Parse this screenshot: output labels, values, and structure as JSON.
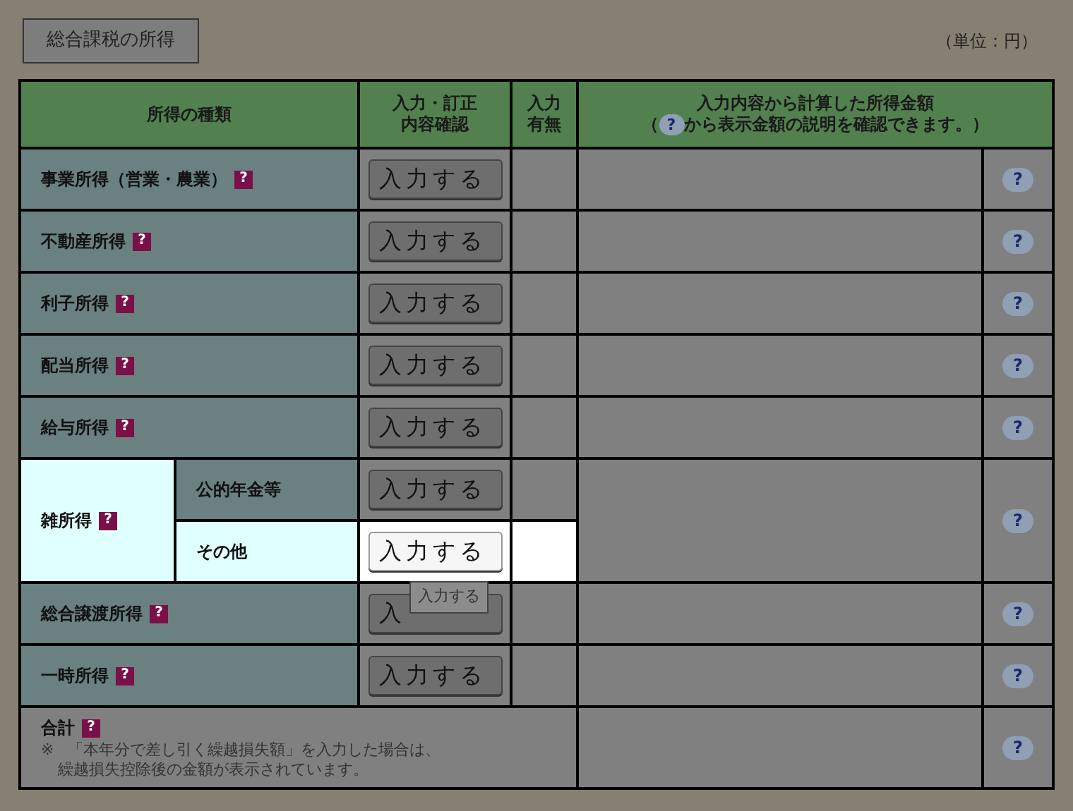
{
  "section_button": "総合課税の所得",
  "unit": "（単位：円）",
  "header": {
    "type": "所得の種類",
    "input": [
      "入力・訂正",
      "内容確認"
    ],
    "has_input": [
      "入力",
      "有無"
    ],
    "amount": "入力内容から計算した所得金額",
    "amount_note_open": "（",
    "amount_note_icon": "?",
    "amount_note": "から表示金額の説明を確認できます。）"
  },
  "rows": [
    {
      "kind": "single",
      "label": "事業所得（営業・農業）",
      "help": "?",
      "button": "入力する",
      "info": "?"
    },
    {
      "kind": "single",
      "label": "不動産所得",
      "help": "?",
      "button": "入力する",
      "info": "?"
    },
    {
      "kind": "single",
      "label": "利子所得",
      "help": "?",
      "button": "入力する",
      "info": "?"
    },
    {
      "kind": "single",
      "label": "配当所得",
      "help": "?",
      "button": "入力する",
      "info": "?"
    },
    {
      "kind": "single",
      "label": "給与所得",
      "help": "?",
      "button": "入力する",
      "info": "?"
    },
    {
      "kind": "group",
      "label": "雑所得",
      "help": "?",
      "highlighted": true,
      "info": "?",
      "children": [
        {
          "label": "公的年金等",
          "button": "入力する",
          "highlighted": false
        },
        {
          "label": "その他",
          "button": "入力する",
          "highlighted": true,
          "tooltip": "入力する"
        }
      ]
    },
    {
      "kind": "single",
      "label": "総合譲渡所得",
      "help": "?",
      "button": "入",
      "info": "?"
    },
    {
      "kind": "single",
      "label": "一時所得",
      "help": "?",
      "button": "入力する",
      "info": "?"
    }
  ],
  "total": {
    "label": "合計",
    "help": "?",
    "note_mark": "※",
    "note": "「本年分で差し引く繰越損失額」を入力した場合は、",
    "note_line2": "繰越損失控除後の金額が表示されています。",
    "info": "?"
  }
}
